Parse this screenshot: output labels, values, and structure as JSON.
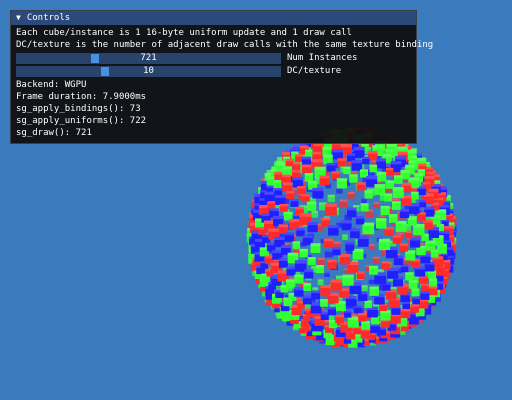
{
  "window": {
    "title": "Controls",
    "collapse_icon": "triangle-down-icon",
    "title_bar_color": "#294a7a",
    "background_color": "#3a7bbd"
  },
  "info": {
    "line1": "Each cube/instance is 1 16-byte uniform update and 1 draw call",
    "line2": "DC/texture is the number of adjacent draw calls with the same texture binding"
  },
  "sliders": [
    {
      "label": "Num Instances",
      "value": "721",
      "fraction": 0.29
    },
    {
      "label": "DC/texture",
      "value": "10",
      "fraction": 0.33
    }
  ],
  "stats": {
    "backend": "Backend: WGPU",
    "frame_duration": "Frame duration: 7.9000ms",
    "apply_bindings": "sg_apply_bindings(): 73",
    "apply_uniforms": "sg_apply_uniforms(): 722",
    "draw": "sg_draw(): 721"
  },
  "scene": {
    "cube_colors": [
      "#ff2a2a",
      "#33ff33",
      "#2020ff"
    ]
  }
}
